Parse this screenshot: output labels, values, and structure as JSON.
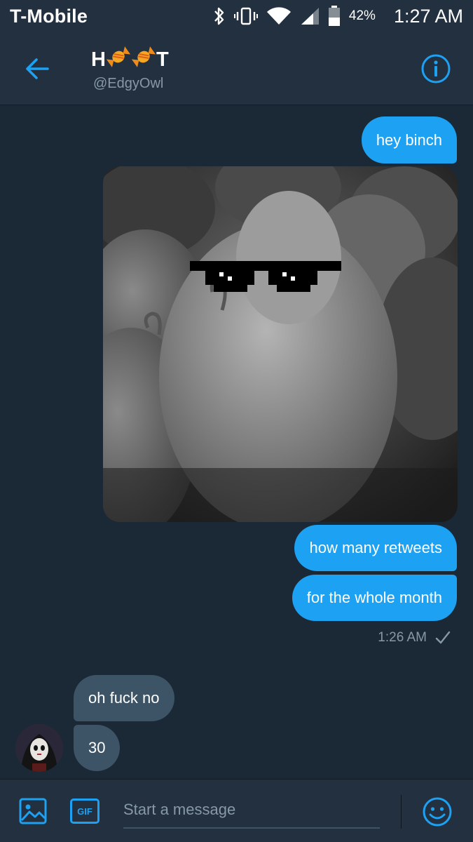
{
  "status_bar": {
    "carrier": "T-Mobile",
    "battery_percent": "42%",
    "time": "1:27 AM",
    "icons": [
      "bluetooth-icon",
      "vibrate-icon",
      "wifi-icon",
      "signal-icon",
      "battery-icon"
    ]
  },
  "header": {
    "title_parts": [
      "H",
      "T"
    ],
    "title_emoji": "candy",
    "handle": "@EdgyOwl",
    "back_icon": "arrow-left-icon",
    "info_icon": "info-icon",
    "accent_color": "#1da1f2"
  },
  "messages": [
    {
      "side": "sent",
      "type": "text",
      "text": "hey binch"
    },
    {
      "side": "sent",
      "type": "image",
      "content": "photo"
    },
    {
      "side": "sent",
      "type": "text",
      "text": "how many retweets"
    },
    {
      "side": "sent",
      "type": "text",
      "text": "for the whole month"
    },
    {
      "side": "received",
      "type": "text",
      "text": "oh fuck no"
    },
    {
      "side": "received",
      "type": "text",
      "text": "30"
    }
  ],
  "sent_meta": {
    "time": "1:26 AM",
    "status_icon": "checkmark-icon"
  },
  "composer": {
    "placeholder": "Start a message",
    "gif_label": "GIF",
    "media_icon": "image-icon",
    "emoji_icon": "smiley-icon"
  },
  "colors": {
    "background": "#1b2836",
    "bar": "#22303f",
    "sent_bubble": "#1da1f2",
    "received_bubble": "#3d5466",
    "muted_text": "#8899a6"
  }
}
